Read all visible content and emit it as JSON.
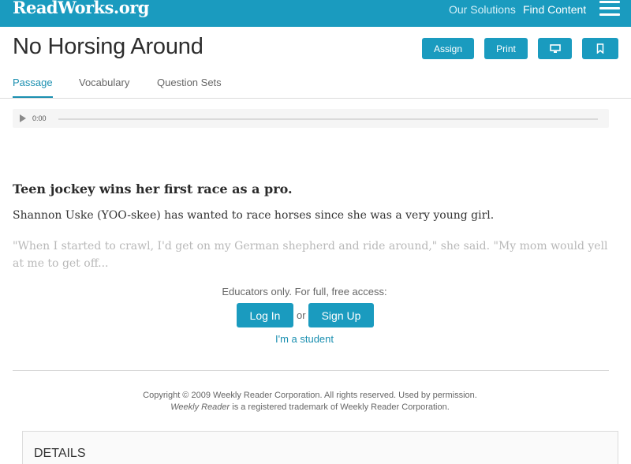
{
  "header": {
    "logo": "ReadWorks.org",
    "nav": [
      "Our Solutions",
      "Find Content"
    ],
    "menu_icon": "hamburger-icon"
  },
  "page": {
    "title": "No Horsing Around",
    "actions": {
      "assign": "Assign",
      "print": "Print",
      "present_icon": "monitor-icon",
      "bookmark_icon": "bookmark-icon"
    }
  },
  "tabs": [
    {
      "label": "Passage",
      "active": true
    },
    {
      "label": "Vocabulary",
      "active": false
    },
    {
      "label": "Question Sets",
      "active": false
    }
  ],
  "audio": {
    "time": "0:00",
    "play_icon": "play-icon"
  },
  "passage": {
    "headline": "Teen jockey wins her first race as a pro.",
    "para1": "Shannon Uske (YOO-skee) has wanted to race horses since she was a very young girl.",
    "para2": "\"When I started to crawl, I'd get on my German shepherd and ride around,\" she said. \"My mom would yell at me to get off..."
  },
  "access": {
    "prompt": "Educators only. For full, free access:",
    "login": "Log In",
    "or": "or",
    "signup": "Sign Up",
    "student": "I'm a student"
  },
  "footer": {
    "copyright": "Copyright © 2009 Weekly Reader Corporation. All rights reserved. Used by permission.",
    "trademark_italic": "Weekly Reader",
    "trademark_rest": " is a registered trademark of Weekly Reader Corporation."
  },
  "details": {
    "label": "DETAILS"
  },
  "colors": {
    "accent": "#1a9bbf",
    "link": "#1a8fb0"
  }
}
